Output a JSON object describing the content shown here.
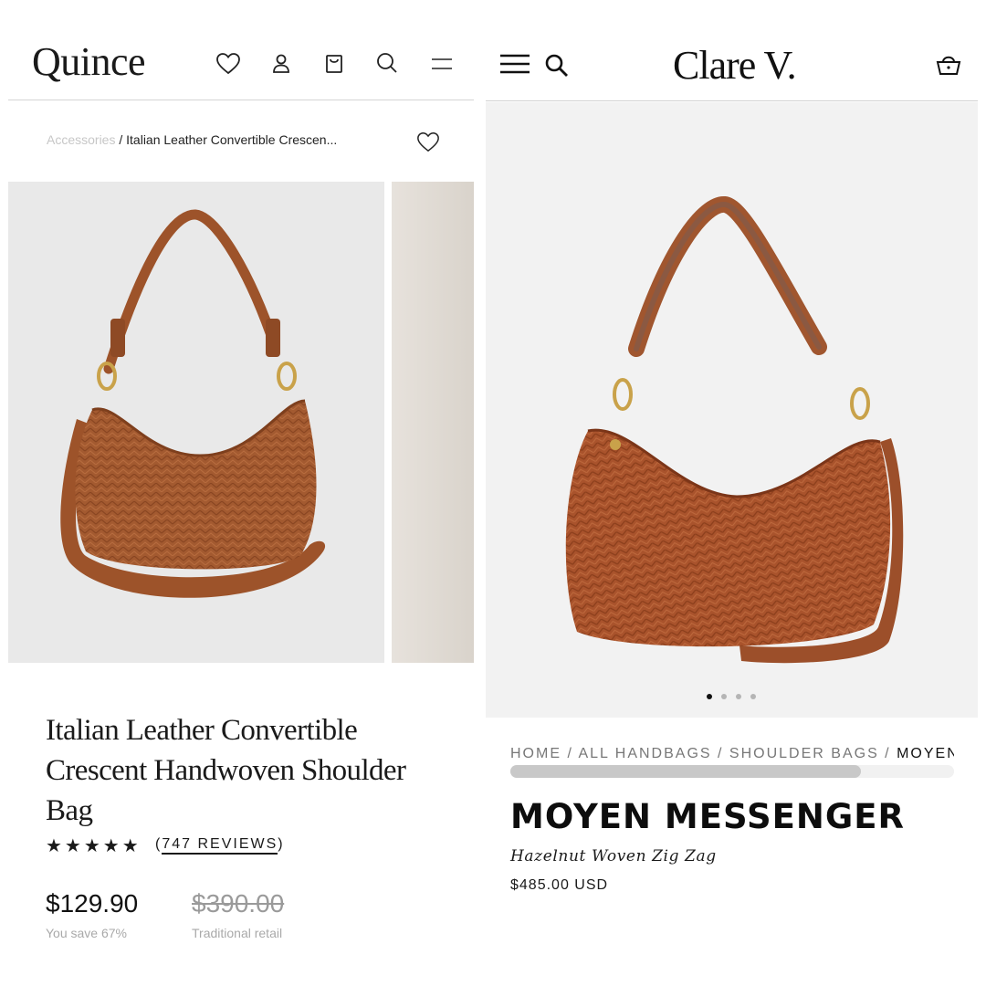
{
  "quince": {
    "logo": "Quince",
    "header_icons": [
      "heart-icon",
      "account-icon",
      "bag-icon",
      "search-icon",
      "menu-icon"
    ],
    "breadcrumb": {
      "parent": "Accessories",
      "separator": " / ",
      "current": "Italian Leather Convertible Crescen..."
    },
    "product": {
      "title": "Italian Leather Convertible Crescent Handwoven Shoulder Bag",
      "stars": "★★★★★",
      "rating": 5,
      "reviews_open": " (",
      "reviews_label": "747 REVIEWS",
      "reviews_close": ")",
      "price": "$129.90",
      "retail_price": "$390.00",
      "savings": "You save 67%",
      "retail_label": "Traditional retail"
    },
    "colors": {
      "bag": "#a35a30",
      "image_bg": "#e9e9e9"
    }
  },
  "clare": {
    "logo": "Clare V.",
    "header_icons": [
      "menu-icon",
      "search-icon",
      "basket-icon"
    ],
    "carousel": {
      "count": 4,
      "active": 1
    },
    "breadcrumb": {
      "items": [
        "HOME",
        "ALL HANDBAGS",
        "SHOULDER BAGS",
        "MOYEN"
      ],
      "separator": " / "
    },
    "breadcrumb_scroll_fraction": 0.79,
    "product": {
      "title": "MOYEN MESSENGER",
      "color": "Hazelnut Woven Zig Zag",
      "price": "$485.00 USD"
    },
    "colors": {
      "bag": "#a9532c",
      "image_bg": "#f2f2f2"
    }
  }
}
